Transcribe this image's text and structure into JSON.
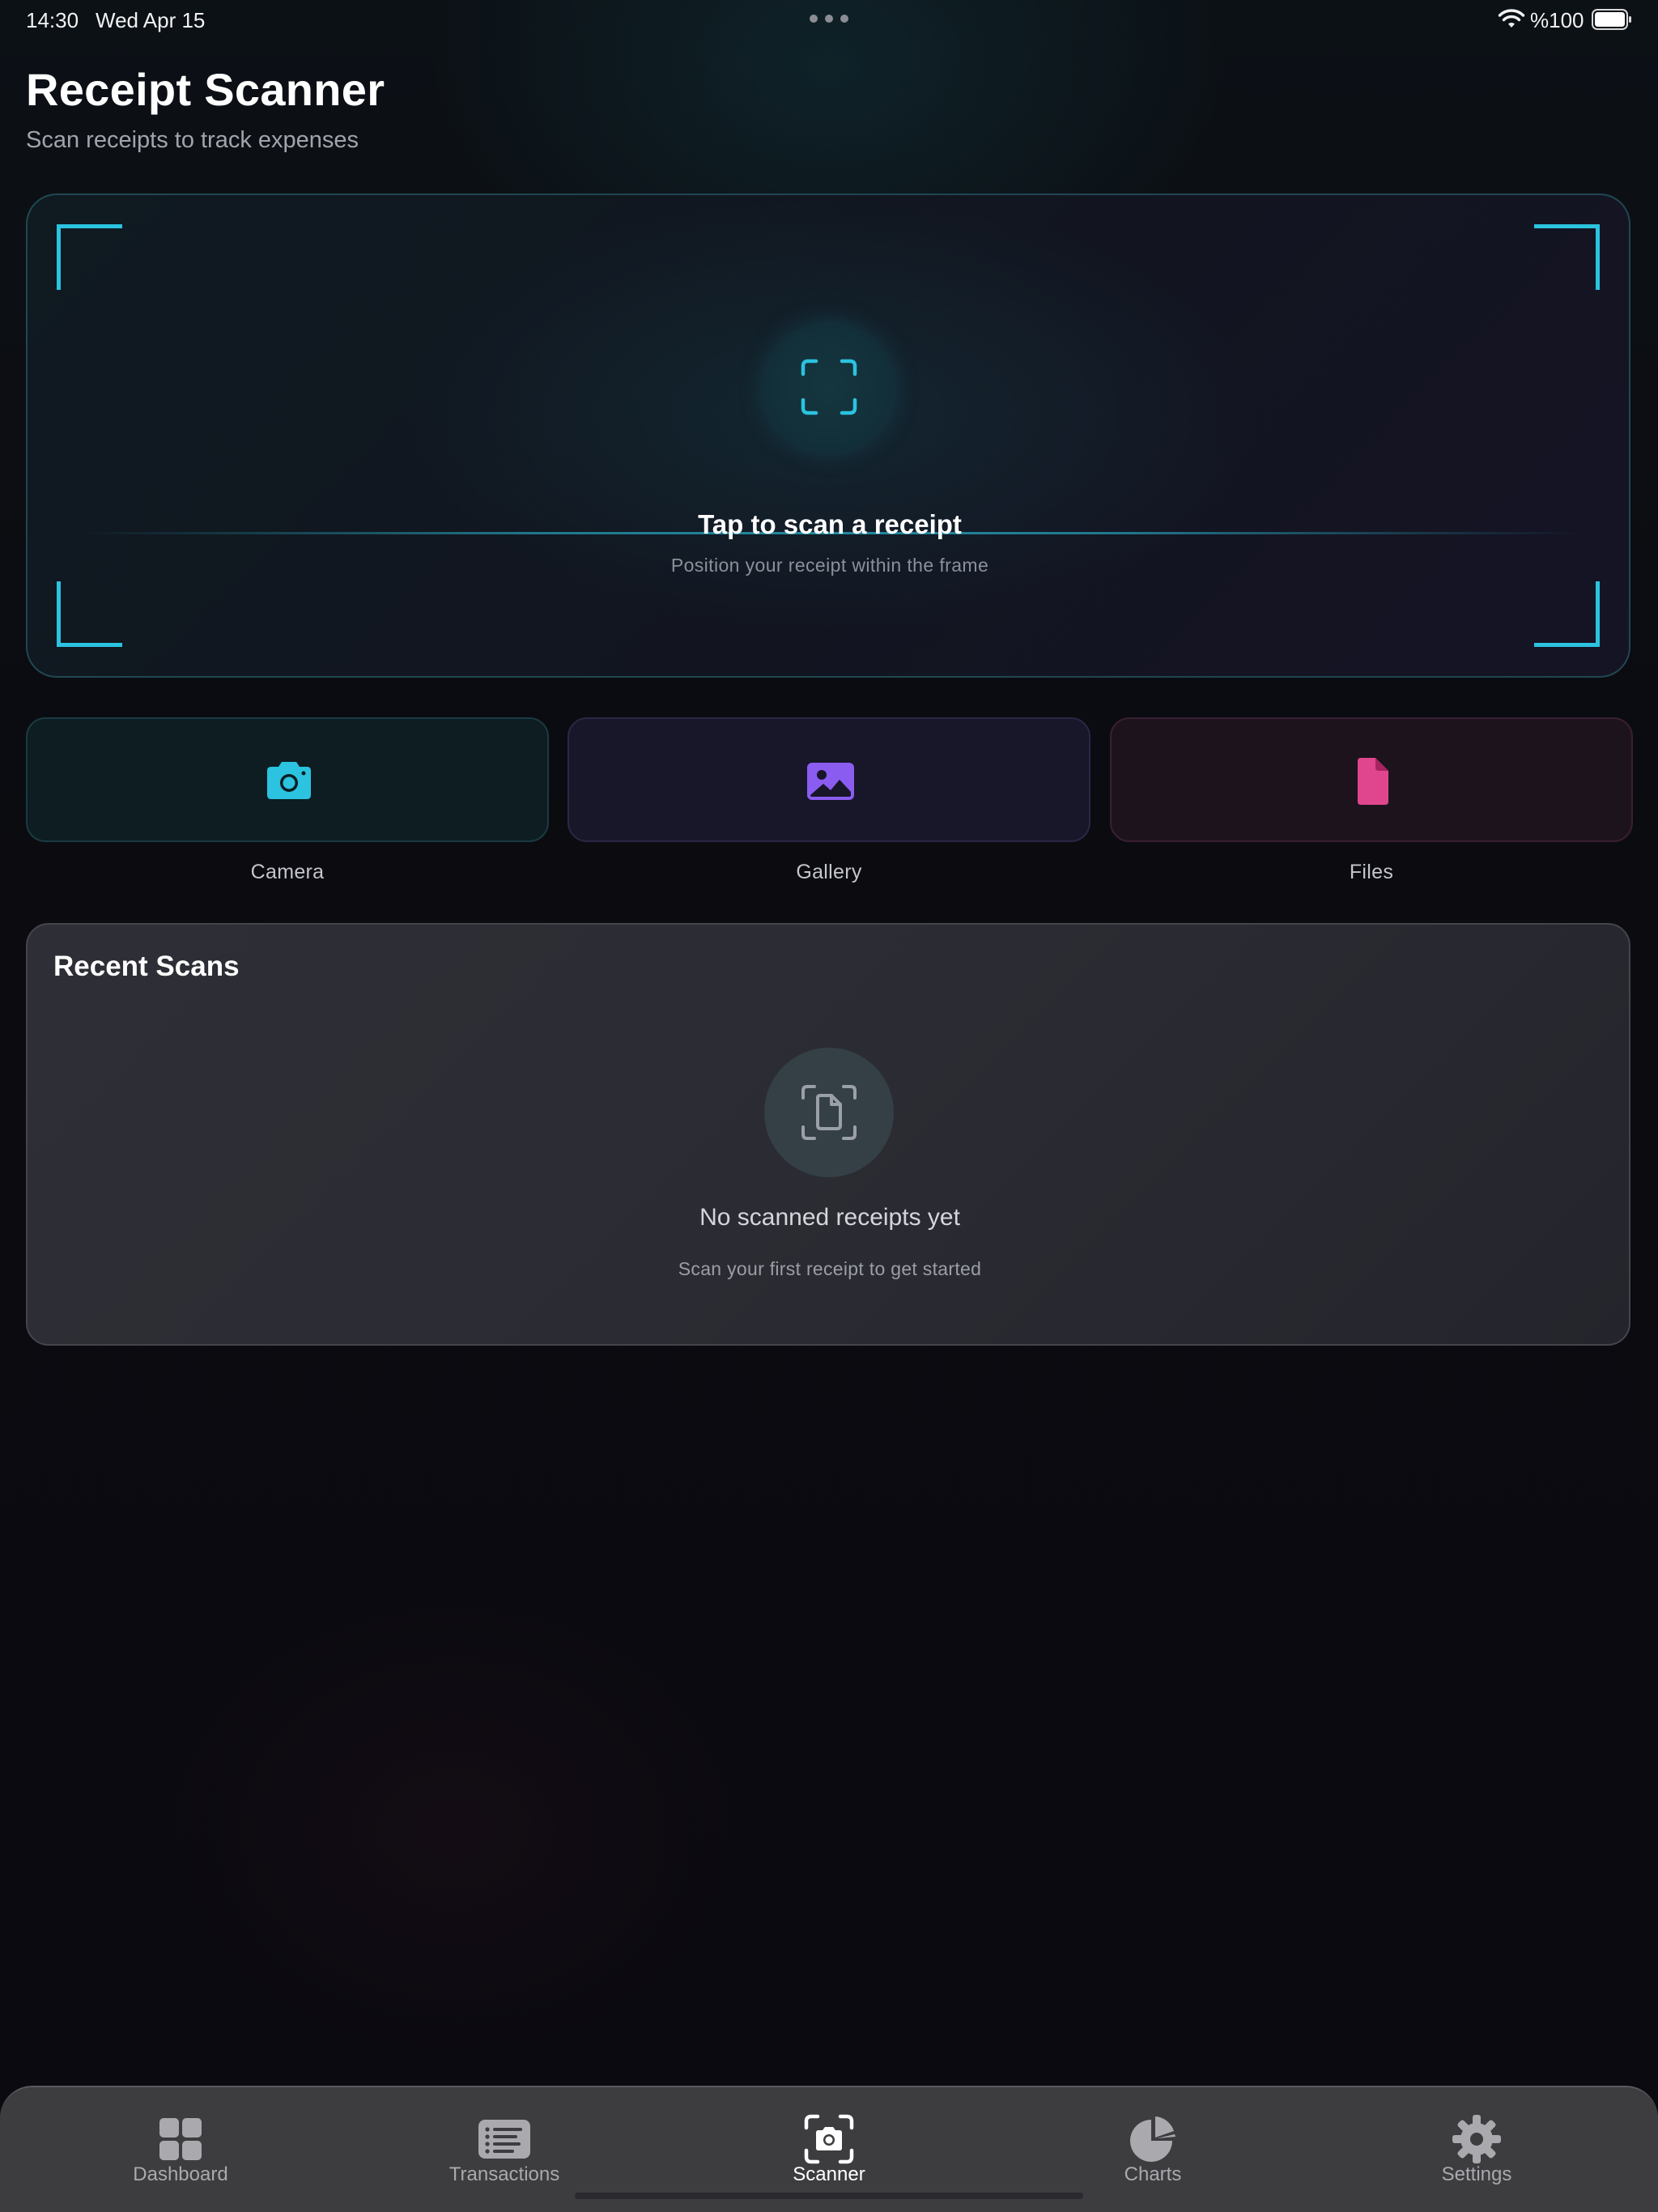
{
  "status_bar": {
    "time": "14:30",
    "date": "Wed Apr 15",
    "battery": "%100",
    "icons": [
      "wifi-icon",
      "battery-icon",
      "more-dots-icon"
    ]
  },
  "header": {
    "title": "Receipt Scanner",
    "subtitle": "Scan receipts to track expenses"
  },
  "scanner": {
    "title": "Tap to scan a receipt",
    "hint": "Position your receipt within the frame",
    "icon": "scan-frame-icon",
    "accent_color": "#2bc3df"
  },
  "sources": [
    {
      "label": "Camera",
      "icon": "camera-icon",
      "color": "#2bc3df"
    },
    {
      "label": "Gallery",
      "icon": "photo-icon",
      "color": "#8a5cf0"
    },
    {
      "label": "Files",
      "icon": "document-icon",
      "color": "#e0468e"
    }
  ],
  "recent_scans": {
    "title": "Recent Scans",
    "empty_title": "No scanned receipts yet",
    "empty_subtitle": "Scan your first receipt to get started",
    "icon": "document-scan-icon"
  },
  "tab_bar": {
    "active": "Scanner",
    "tabs": [
      {
        "label": "Dashboard",
        "icon": "grid-icon"
      },
      {
        "label": "Transactions",
        "icon": "list-icon"
      },
      {
        "label": "Scanner",
        "icon": "camera-scan-icon"
      },
      {
        "label": "Charts",
        "icon": "pie-chart-icon"
      },
      {
        "label": "Settings",
        "icon": "gear-icon"
      }
    ]
  }
}
